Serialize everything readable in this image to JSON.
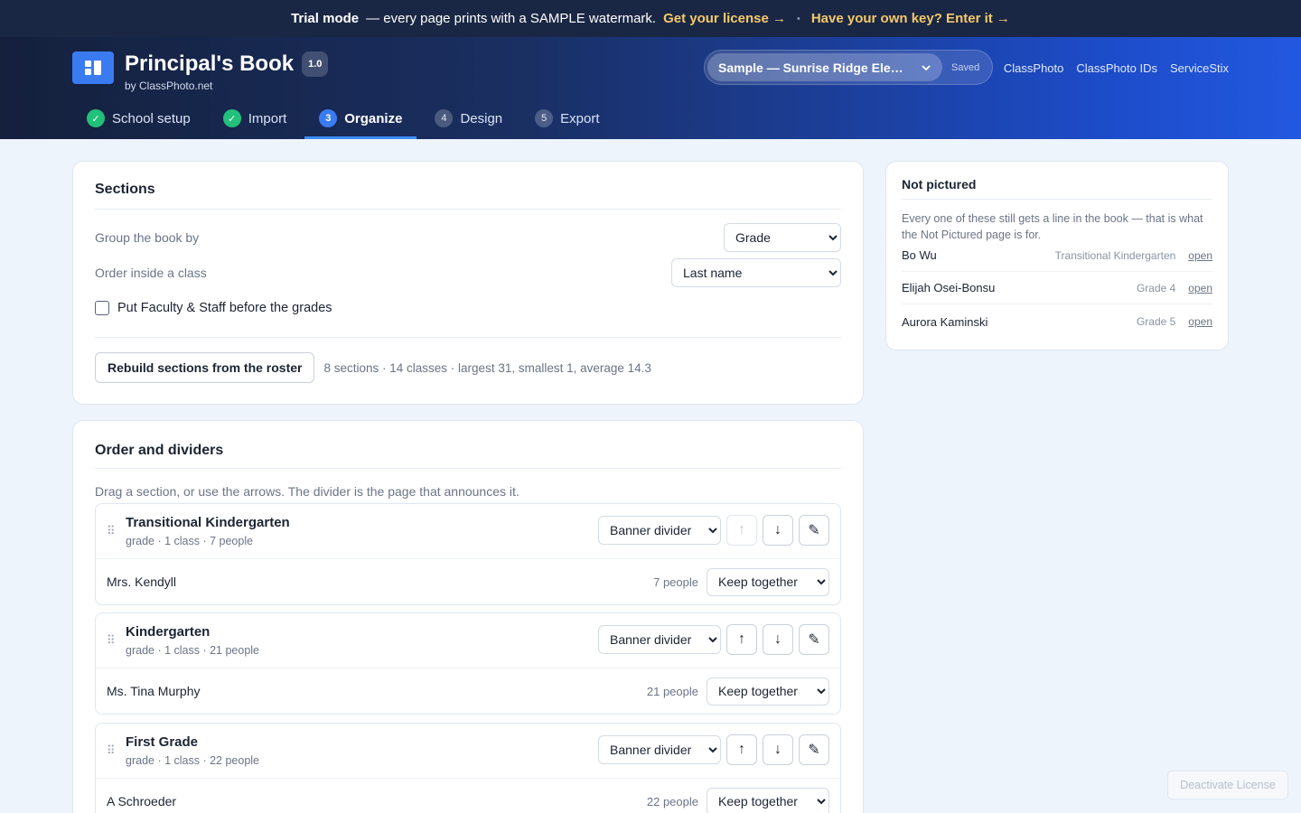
{
  "trial": {
    "label": "Trial mode",
    "message": "— every page prints with a SAMPLE watermark.",
    "license_link": "Get your license →",
    "key_link": "Have your own key? Enter it →"
  },
  "brand": {
    "title": "Principal's Book",
    "version": "1.0",
    "byline": "by ClassPhoto.net"
  },
  "document": {
    "name": "Sample — Sunrise Ridge Elementary",
    "status": "Saved"
  },
  "top_links": [
    "ClassPhoto",
    "ClassPhoto IDs",
    "ServiceStix"
  ],
  "steps": [
    {
      "num": "✓",
      "label": "School setup"
    },
    {
      "num": "✓",
      "label": "Import"
    },
    {
      "num": "3",
      "label": "Organize"
    },
    {
      "num": "4",
      "label": "Design"
    },
    {
      "num": "5",
      "label": "Export"
    }
  ],
  "sections": {
    "title": "Sections",
    "group_label": "Group the book by",
    "group_value": "Grade",
    "order_label": "Order inside a class",
    "order_value": "Last name",
    "faculty_label": "Put Faculty & Staff before the grades",
    "faculty_checked": false,
    "rebuild_button": "Rebuild sections from the roster",
    "summary": "8 sections · 14 classes · largest 31, smallest 1, average 14.3"
  },
  "order": {
    "title": "Order and dividers",
    "hint": "Drag a section, or use the arrows. The divider is the page that announces it.",
    "groups": [
      {
        "title": "Transitional Kindergarten",
        "sub": "grade · 1 class · 7 people",
        "divider": "Banner divider",
        "teacher": "Mrs. Kendyll",
        "count": "7 people",
        "keep": "Keep together"
      },
      {
        "title": "Kindergarten",
        "sub": "grade · 1 class · 21 people",
        "divider": "Banner divider",
        "teacher": "Ms. Tina Murphy",
        "count": "21 people",
        "keep": "Keep together"
      },
      {
        "title": "First Grade",
        "sub": "grade · 1 class · 22 people",
        "divider": "Banner divider",
        "teacher": "A Schroeder",
        "count": "22 people",
        "keep": "Keep together"
      }
    ]
  },
  "not_pictured": {
    "title": "Not pictured",
    "note": "Every one of these still gets a line in the book — that is what the Not Pictured page is for.",
    "open_label": "open",
    "people": [
      {
        "name": "Bo Wu",
        "grade": "Transitional Kindergarten"
      },
      {
        "name": "Elijah Osei-Bonsu",
        "grade": "Grade 4"
      },
      {
        "name": "Aurora Kaminski",
        "grade": "Grade 5"
      }
    ]
  },
  "deactivate_button": "Deactivate License",
  "icons": {
    "drag": "drag-handle-icon",
    "up": "arrow-up-icon",
    "down": "arrow-down-icon",
    "edit": "pencil-icon",
    "check": "check-icon",
    "chevron": "chevron-down-icon"
  },
  "colors": {
    "accent": "#3a7bf2",
    "trial_link": "#f5c96a",
    "done": "#22c07a"
  }
}
